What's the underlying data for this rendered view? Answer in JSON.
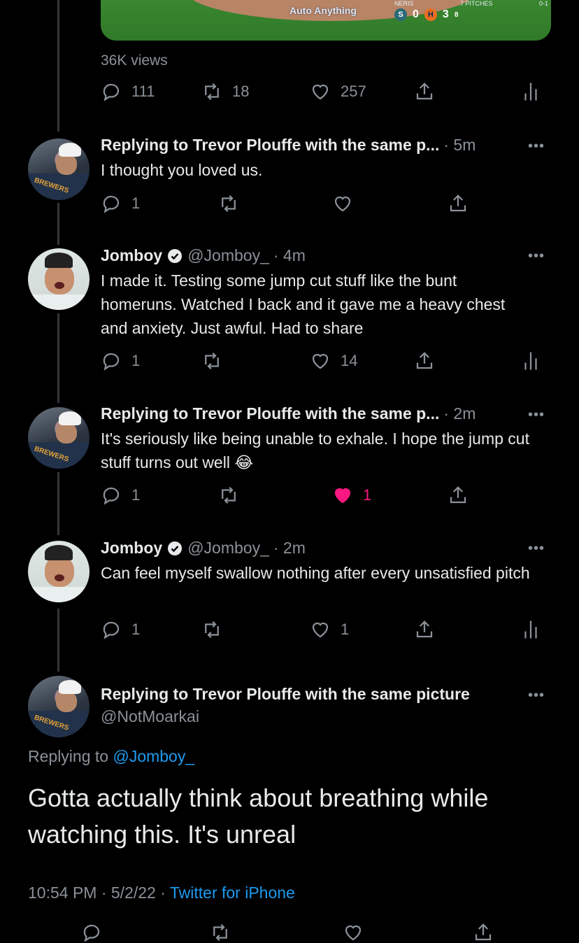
{
  "media": {
    "ad_text": "Auto Anything",
    "score_team": "NERIS",
    "score_pitches": "7 PITCHES",
    "score_count": "0-1",
    "away_score": "0",
    "home_score": "3",
    "inning": "8"
  },
  "main_tweet": {
    "views": "36K views",
    "replies": "111",
    "retweets": "18",
    "likes": "257"
  },
  "replies": [
    {
      "header": "Replying to Trevor Plouffe with the same p...",
      "time": "· 5m",
      "text": "I thought you loved us.",
      "replies": "1",
      "likes": ""
    },
    {
      "name": "Jomboy",
      "handle": "@Jomboy_",
      "time": "· 4m",
      "text": "I made it. Testing some jump cut stuff like the bunt homeruns. Watched I back and it gave me a heavy chest and anxiety. Just awful. Had to share",
      "replies": "1",
      "likes": "14"
    },
    {
      "header": "Replying to Trevor Plouffe with the same p...",
      "time": "· 2m",
      "text": "It's seriously like being unable to exhale. I hope the jump cut stuff turns out well",
      "emoji": "😂",
      "replies": "1",
      "likes": "1"
    },
    {
      "name": "Jomboy",
      "handle": "@Jomboy_",
      "time": "· 2m",
      "text": "Can feel myself swallow nothing after every unsatisfied pitch",
      "replies": "1",
      "likes": "1"
    }
  ],
  "focused": {
    "name": "Replying to Trevor Plouffe with the same picture",
    "handle": "@NotMoarkai",
    "replying_prefix": "Replying to",
    "replying_to": "@Jomboy_",
    "text": "Gotta actually think about breathing while watching this. It's unreal",
    "time": "10:54 PM",
    "date": "· 5/2/22 ·",
    "source": "Twitter for iPhone"
  },
  "more_label": "•••",
  "colors": {
    "like_active": "#f91880",
    "link": "#1d9bf0",
    "muted": "#8b9199"
  }
}
